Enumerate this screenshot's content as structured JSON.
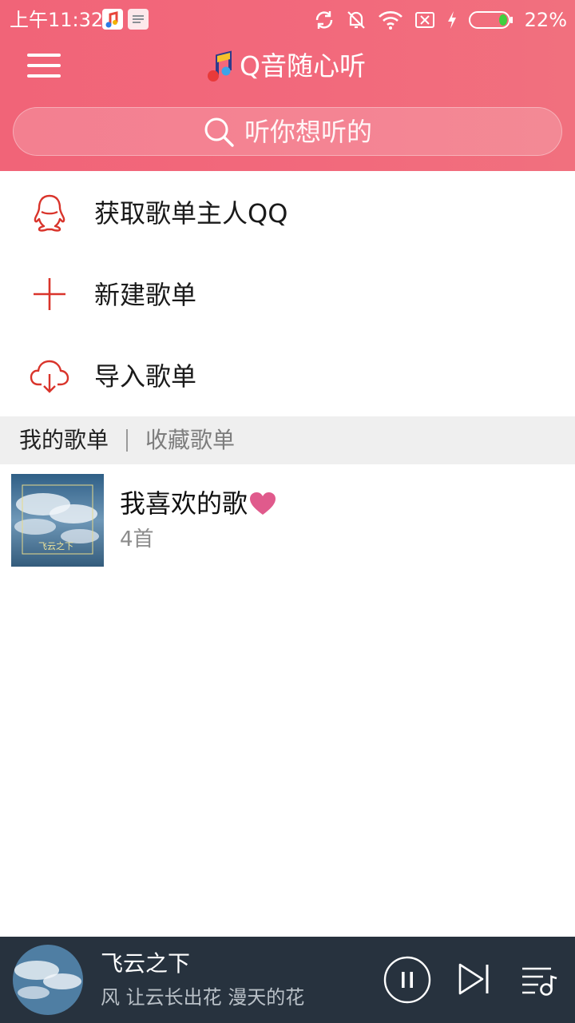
{
  "status_bar": {
    "time": "上午11:32",
    "battery": "22%"
  },
  "header": {
    "title": "Q音随心听",
    "search_placeholder": "听你想听的"
  },
  "actions": [
    {
      "label": "获取歌单主人QQ",
      "icon": "qq-penguin-icon"
    },
    {
      "label": "新建歌单",
      "icon": "plus-icon"
    },
    {
      "label": "导入歌单",
      "icon": "cloud-download-icon"
    }
  ],
  "tabs": {
    "mine": "我的歌单",
    "favorites": "收藏歌单"
  },
  "playlists": [
    {
      "title": "我喜欢的歌",
      "count": "4首",
      "cover_text": "飞云之下"
    }
  ],
  "player": {
    "song_title": "飞云之下",
    "lyric": "风 让云长出花 漫天的花",
    "state": "playing"
  },
  "colors": {
    "header_accent": "#f16478",
    "action_icon": "#d9342b",
    "heart": "#e05a8c",
    "player_bg": "#27323e"
  }
}
